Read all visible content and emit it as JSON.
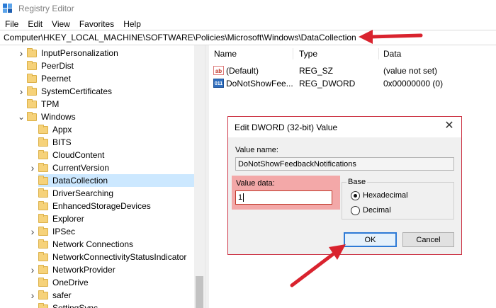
{
  "window": {
    "title": "Registry Editor"
  },
  "menu": [
    "File",
    "Edit",
    "View",
    "Favorites",
    "Help"
  ],
  "address": {
    "path": "Computer\\HKEY_LOCAL_MACHINE\\SOFTWARE\\Policies\\Microsoft\\Windows\\DataCollection"
  },
  "tree": {
    "items": [
      {
        "label": "InputPersonalization",
        "level": 1,
        "expander": "right"
      },
      {
        "label": "PeerDist",
        "level": 1,
        "expander": "none"
      },
      {
        "label": "Peernet",
        "level": 1,
        "expander": "none"
      },
      {
        "label": "SystemCertificates",
        "level": 1,
        "expander": "right"
      },
      {
        "label": "TPM",
        "level": 1,
        "expander": "none"
      },
      {
        "label": "Windows",
        "level": 1,
        "expander": "down"
      },
      {
        "label": "Appx",
        "level": 2,
        "expander": "none"
      },
      {
        "label": "BITS",
        "level": 2,
        "expander": "none"
      },
      {
        "label": "CloudContent",
        "level": 2,
        "expander": "none"
      },
      {
        "label": "CurrentVersion",
        "level": 2,
        "expander": "right"
      },
      {
        "label": "DataCollection",
        "level": 2,
        "expander": "none",
        "selected": true
      },
      {
        "label": "DriverSearching",
        "level": 2,
        "expander": "none"
      },
      {
        "label": "EnhancedStorageDevices",
        "level": 2,
        "expander": "none"
      },
      {
        "label": "Explorer",
        "level": 2,
        "expander": "none"
      },
      {
        "label": "IPSec",
        "level": 2,
        "expander": "right"
      },
      {
        "label": "Network Connections",
        "level": 2,
        "expander": "none"
      },
      {
        "label": "NetworkConnectivityStatusIndicator",
        "level": 2,
        "expander": "none"
      },
      {
        "label": "NetworkProvider",
        "level": 2,
        "expander": "right"
      },
      {
        "label": "OneDrive",
        "level": 2,
        "expander": "none"
      },
      {
        "label": "safer",
        "level": 2,
        "expander": "right"
      },
      {
        "label": "SettingSync",
        "level": 2,
        "expander": "none"
      }
    ]
  },
  "list": {
    "columns": [
      "Name",
      "Type",
      "Data"
    ],
    "rows": [
      {
        "name": "(Default)",
        "type": "REG_SZ",
        "data": "(value not set)",
        "icon": "string-value-icon"
      },
      {
        "name": "DoNotShowFee...",
        "type": "REG_DWORD",
        "data": "0x00000000 (0)",
        "icon": "dword-value-icon"
      }
    ]
  },
  "dialog": {
    "title": "Edit DWORD (32-bit) Value",
    "value_name_label": "Value name:",
    "value_name": "DoNotShowFeedbackNotifications",
    "value_data_label": "Value data:",
    "value_data": "1",
    "base_label": "Base",
    "base_options": [
      {
        "label": "Hexadecimal",
        "checked": true
      },
      {
        "label": "Decimal",
        "checked": false
      }
    ],
    "ok_label": "OK",
    "cancel_label": "Cancel"
  },
  "colors": {
    "annotation": "#d9232e",
    "selection": "#cce8ff",
    "highlight": "#f3a8a8"
  }
}
